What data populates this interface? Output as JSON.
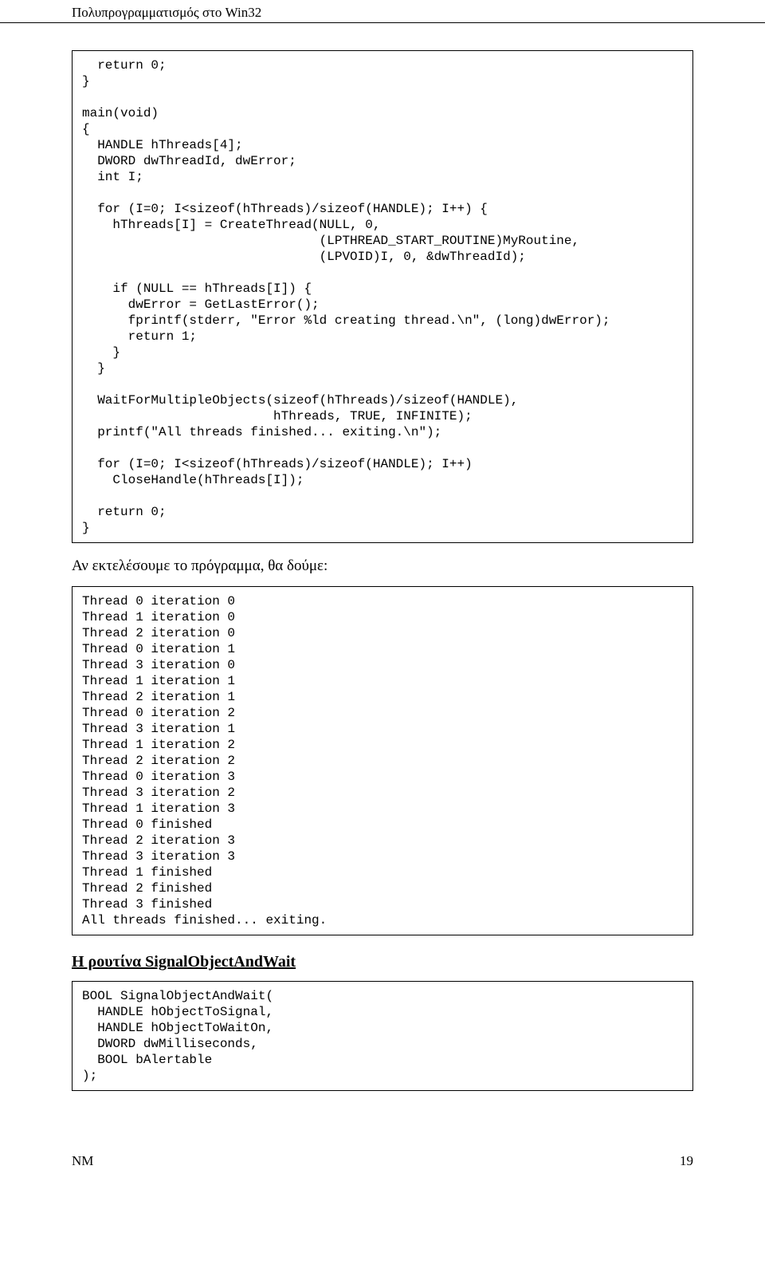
{
  "header": {
    "title": "Πολυπρογραμματισμός στο Win32"
  },
  "code_block_1": "  return 0;\n}\n\nmain(void)\n{\n  HANDLE hThreads[4];\n  DWORD dwThreadId, dwError;\n  int I;\n\n  for (I=0; I<sizeof(hThreads)/sizeof(HANDLE); I++) {\n    hThreads[I] = CreateThread(NULL, 0,\n                               (LPTHREAD_START_ROUTINE)MyRoutine,\n                               (LPVOID)I, 0, &dwThreadId);\n\n    if (NULL == hThreads[I]) {\n      dwError = GetLastError();\n      fprintf(stderr, \"Error %ld creating thread.\\n\", (long)dwError);\n      return 1;\n    }\n  }\n\n  WaitForMultipleObjects(sizeof(hThreads)/sizeof(HANDLE),\n                         hThreads, TRUE, INFINITE);\n  printf(\"All threads finished... exiting.\\n\");\n\n  for (I=0; I<sizeof(hThreads)/sizeof(HANDLE); I++)\n    CloseHandle(hThreads[I]);\n\n  return 0;\n}",
  "paragraph_1": "Αν εκτελέσουμε το πρόγραμμα, θα δούμε:",
  "code_block_2": "Thread 0 iteration 0\nThread 1 iteration 0\nThread 2 iteration 0\nThread 0 iteration 1\nThread 3 iteration 0\nThread 1 iteration 1\nThread 2 iteration 1\nThread 0 iteration 2\nThread 3 iteration 1\nThread 1 iteration 2\nThread 2 iteration 2\nThread 0 iteration 3\nThread 3 iteration 2\nThread 1 iteration 3\nThread 0 finished\nThread 2 iteration 3\nThread 3 iteration 3\nThread 1 finished\nThread 2 finished\nThread 3 finished\nAll threads finished... exiting.",
  "section_heading": "Η ρουτίνα SignalObjectAndWait",
  "code_block_3": "BOOL SignalObjectAndWait(\n  HANDLE hObjectToSignal,\n  HANDLE hObjectToWaitOn,\n  DWORD dwMilliseconds,\n  BOOL bAlertable\n);",
  "footer": {
    "left": "NM",
    "right": "19"
  }
}
